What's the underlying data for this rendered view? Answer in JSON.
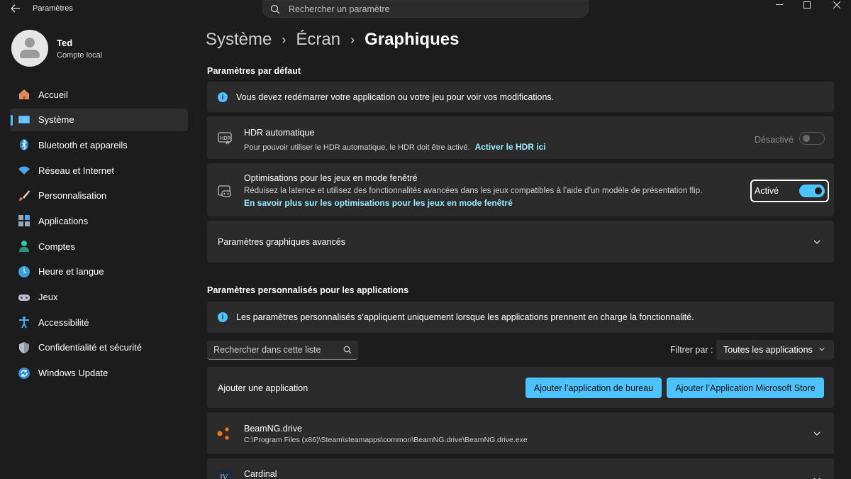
{
  "window": {
    "title": "Paramètres",
    "search_placeholder": "Rechercher un paramètre"
  },
  "profile": {
    "name": "Ted",
    "account_type": "Compte local"
  },
  "sidebar": {
    "items": [
      {
        "label": "Accueil",
        "icon": "home-icon"
      },
      {
        "label": "Système",
        "icon": "system-icon",
        "active": true
      },
      {
        "label": "Bluetooth et appareils",
        "icon": "bluetooth-icon"
      },
      {
        "label": "Réseau et Internet",
        "icon": "wifi-icon"
      },
      {
        "label": "Personnalisation",
        "icon": "brush-icon"
      },
      {
        "label": "Applications",
        "icon": "apps-icon"
      },
      {
        "label": "Comptes",
        "icon": "account-icon"
      },
      {
        "label": "Heure et langue",
        "icon": "time-language-icon"
      },
      {
        "label": "Jeux",
        "icon": "gamepad-icon"
      },
      {
        "label": "Accessibilité",
        "icon": "accessibility-icon"
      },
      {
        "label": "Confidentialité et sécurité",
        "icon": "shield-icon"
      },
      {
        "label": "Windows Update",
        "icon": "update-icon"
      }
    ]
  },
  "breadcrumb": {
    "items": [
      "Système",
      "Écran",
      "Graphiques"
    ]
  },
  "defaults": {
    "title": "Paramètres par défaut",
    "restart_info": "Vous devez redémarrer votre application ou votre jeu pour voir vos modifications.",
    "hdr": {
      "title": "HDR automatique",
      "description": "Pour pouvoir utiliser le HDR automatique, le HDR doit être activé.",
      "link": "Activer le HDR ici",
      "state_label": "Désactivé",
      "enabled": false
    },
    "windowed": {
      "title": "Optimisations pour les jeux en mode fenêtré",
      "description": "Réduisez la latence et utilisez des fonctionnalités avancées dans les jeux compatibles à l’aide d’un modèle de présentation flip.",
      "link": "En savoir plus sur les optimisations pour les jeux en mode fenêtré",
      "state_label": "Activé",
      "enabled": true
    },
    "advanced": {
      "title": "Paramètres graphiques avancés"
    }
  },
  "custom": {
    "title": "Paramètres personnalisés pour les applications",
    "info": "Les paramètres personnalisés s’appliquent uniquement lorsque les applications prennent en charge la fonctionnalité.",
    "search_placeholder": "Rechercher dans cette liste",
    "filter_label": "Filtrer par :",
    "filter_value": "Toutes les applications",
    "add_app": {
      "label": "Ajouter une application",
      "desktop_button": "Ajouter l’application de bureau",
      "store_button": "Ajouter l’Application Microsoft Store"
    },
    "apps": [
      {
        "name": "BeamNG.drive",
        "path": "C:\\Program Files (x86)\\Steam\\steamapps\\common\\BeamNG.drive\\BeamNG.drive.exe",
        "icon": "beamng-icon"
      },
      {
        "name": "Cardinal",
        "path": "",
        "icon": "cardinal-icon"
      }
    ]
  },
  "colors": {
    "accent": "#4cc2ff",
    "link": "#99ebff",
    "background": "#1c1c1c",
    "card": "#2b2b2b"
  }
}
